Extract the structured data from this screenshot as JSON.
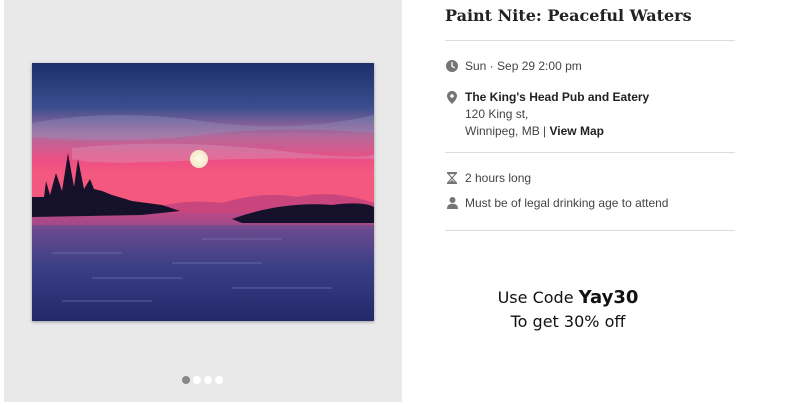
{
  "event": {
    "title": "Paint Nite: Peaceful Waters",
    "date_time": "Sun · Sep 29 2:00 pm",
    "venue": {
      "name": "The King's Head Pub and Eatery",
      "street": "120 King st,",
      "city": "Winnipeg, MB",
      "separator": " | ",
      "map_link": "View Map"
    },
    "duration": "2 hours long",
    "age_requirement": "Must be of legal drinking age to attend"
  },
  "gallery": {
    "slide_count": 4,
    "active_slide": 1
  },
  "promo": {
    "prefix": "Use Code ",
    "code": "Yay30",
    "line2": "To get 30% off"
  },
  "icons": {
    "date": "clock-icon",
    "location": "map-pin-icon",
    "duration": "hourglass-icon",
    "age": "person-icon"
  },
  "colors": {
    "gallery_bg": "#e9e9e9",
    "divider": "#dcdcdc",
    "icon": "#757575"
  }
}
